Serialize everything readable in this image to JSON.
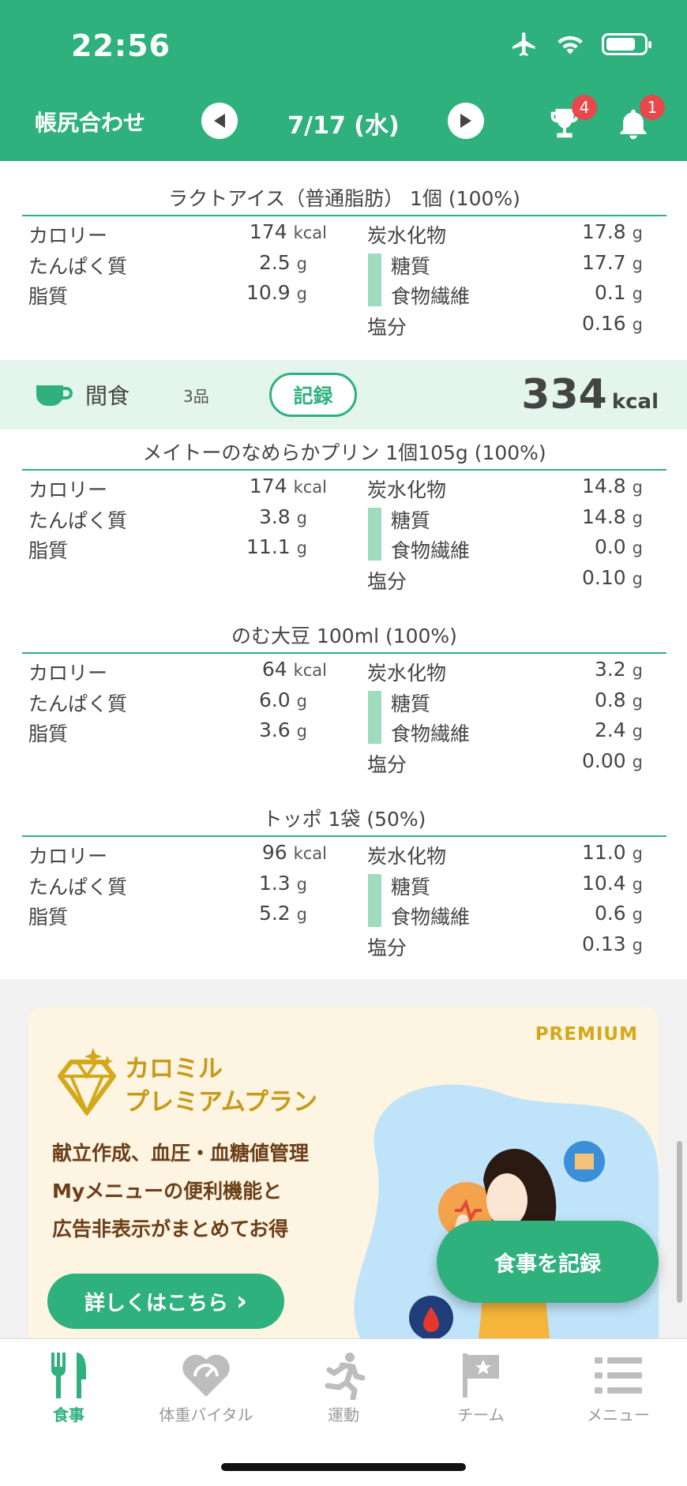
{
  "status_bar": {
    "time": "22:56"
  },
  "header": {
    "left_link": "帳尻合わせ",
    "date": "7/17 (水)",
    "trophy_badge": "4",
    "bell_badge": "1",
    "color": "#2fb17e"
  },
  "foods": [
    {
      "title": "ラクトアイス（普通脂肪） 1個 (100%)",
      "kcal": "174",
      "protein": "2.5",
      "fat": "10.9",
      "carbs": "17.8",
      "sugar": "17.7",
      "fiber": "0.1",
      "salt": "0.16"
    },
    {
      "title": "メイトーのなめらかプリン 1個105g (100%)",
      "kcal": "174",
      "protein": "3.8",
      "fat": "11.1",
      "carbs": "14.8",
      "sugar": "14.8",
      "fiber": "0.0",
      "salt": "0.10"
    },
    {
      "title": "のむ大豆 100ml (100%)",
      "kcal": "64",
      "protein": "6.0",
      "fat": "3.6",
      "carbs": "3.2",
      "sugar": "0.8",
      "fiber": "2.4",
      "salt": "0.00"
    },
    {
      "title": "トッポ 1袋 (50%)",
      "kcal": "96",
      "protein": "1.3",
      "fat": "5.2",
      "carbs": "11.0",
      "sugar": "10.4",
      "fiber": "0.6",
      "salt": "0.13"
    }
  ],
  "labels": {
    "calorie": "カロリー",
    "protein": "たんぱく質",
    "fat": "脂質",
    "carbs": "炭水化物",
    "sugar": "糖質",
    "fiber": "食物繊維",
    "salt": "塩分",
    "kcal_unit": "kcal",
    "g_unit": "g"
  },
  "snack": {
    "label": "間食",
    "count": "3品",
    "record_button": "記録",
    "total_kcal": "334",
    "unit": "kcal"
  },
  "banner": {
    "tag": "PREMIUM",
    "brand_line1": "カロミル",
    "brand_line2": "プレミアムプラン",
    "promo_line1": "献立作成、血圧・血糖値管理",
    "promo_line2": "Myメニューの便利機能と",
    "promo_line3": "広告非表示がまとめてお得",
    "button": "詳しくはこちら",
    "chevron": "›"
  },
  "fab": {
    "label": "食事を記録"
  },
  "tabs": [
    {
      "label": "食事",
      "icon": "fork-knife-icon",
      "active": true
    },
    {
      "label": "体重バイタル",
      "icon": "heart-scale-icon",
      "active": false
    },
    {
      "label": "運動",
      "icon": "runner-icon",
      "active": false
    },
    {
      "label": "チーム",
      "icon": "flag-icon",
      "active": false
    },
    {
      "label": "メニュー",
      "icon": "list-menu-icon",
      "active": false
    }
  ]
}
